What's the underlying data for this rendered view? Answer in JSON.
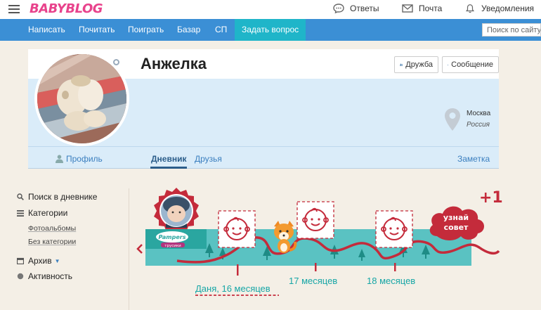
{
  "header": {
    "logo_text": "BABYBLOG",
    "links": [
      {
        "label": "Ответы",
        "icon": "chat-bubble-icon"
      },
      {
        "label": "Почта",
        "icon": "envelope-icon"
      },
      {
        "label": "Уведомления",
        "icon": "bell-icon"
      }
    ]
  },
  "nav": {
    "items": [
      "Написать",
      "Почитать",
      "Поиграть",
      "Базар",
      "СП"
    ],
    "active_item": "Задать вопрос",
    "search_placeholder": "Поиск по сайту"
  },
  "profile": {
    "name": "Анжелка",
    "friend_button": "Дружба",
    "message_button": "Сообщение",
    "city": "Москва",
    "country": "Россия",
    "profile_link": "Профиль",
    "tabs": {
      "diary": "Дневник",
      "friends": "Друзья"
    },
    "note_link": "Заметка"
  },
  "sidebar": {
    "search": "Поиск в дневнике",
    "categories": "Категории",
    "sub": [
      "Фотоальбомы",
      "Без категории"
    ],
    "archive": "Архив",
    "activity": "Активность"
  },
  "banner": {
    "plus": "+1",
    "cloud_line1": "узнай",
    "cloud_line2": "совет",
    "brand": "Pampers",
    "brand_sub": "трусики",
    "ages": [
      "Даня, 16 месяцев",
      "17 месяцев",
      "18 месяцев"
    ]
  },
  "colors": {
    "nav_blue": "#3b8fd5",
    "nav_active": "#1fb5c9",
    "logo_pink": "#e8438c",
    "panel_blue": "#daecf9",
    "banner_red": "#c42b3b",
    "banner_teal": "#5ac2c2"
  }
}
